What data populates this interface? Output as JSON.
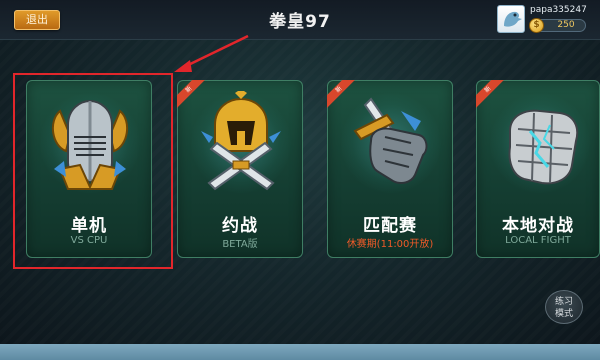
{
  "topbar": {
    "back_label": "退出",
    "title": "拳皇97",
    "username": "papa335247",
    "coins": "250"
  },
  "modes": [
    {
      "name": "单机",
      "sub": "VS CPU",
      "emblem": "knight-helmet-icon",
      "tag": ""
    },
    {
      "name": "约战",
      "sub": "BETA版",
      "emblem": "crossed-swords-helmet-icon",
      "tag": "新"
    },
    {
      "name": "匹配赛",
      "sub": "休赛期(11:00开放)",
      "emblem": "fist-sword-icon",
      "tag": "新"
    },
    {
      "name": "本地对战",
      "sub": "LOCAL FIGHT",
      "emblem": "stone-fist-icon",
      "tag": "新"
    }
  ],
  "practice": {
    "line1": "练习",
    "line2": "模式"
  },
  "colors": {
    "accent": "#e09a2a",
    "card_bg": "#1d5240",
    "highlight": "#e2262b",
    "warning_text": "#f05a28"
  }
}
